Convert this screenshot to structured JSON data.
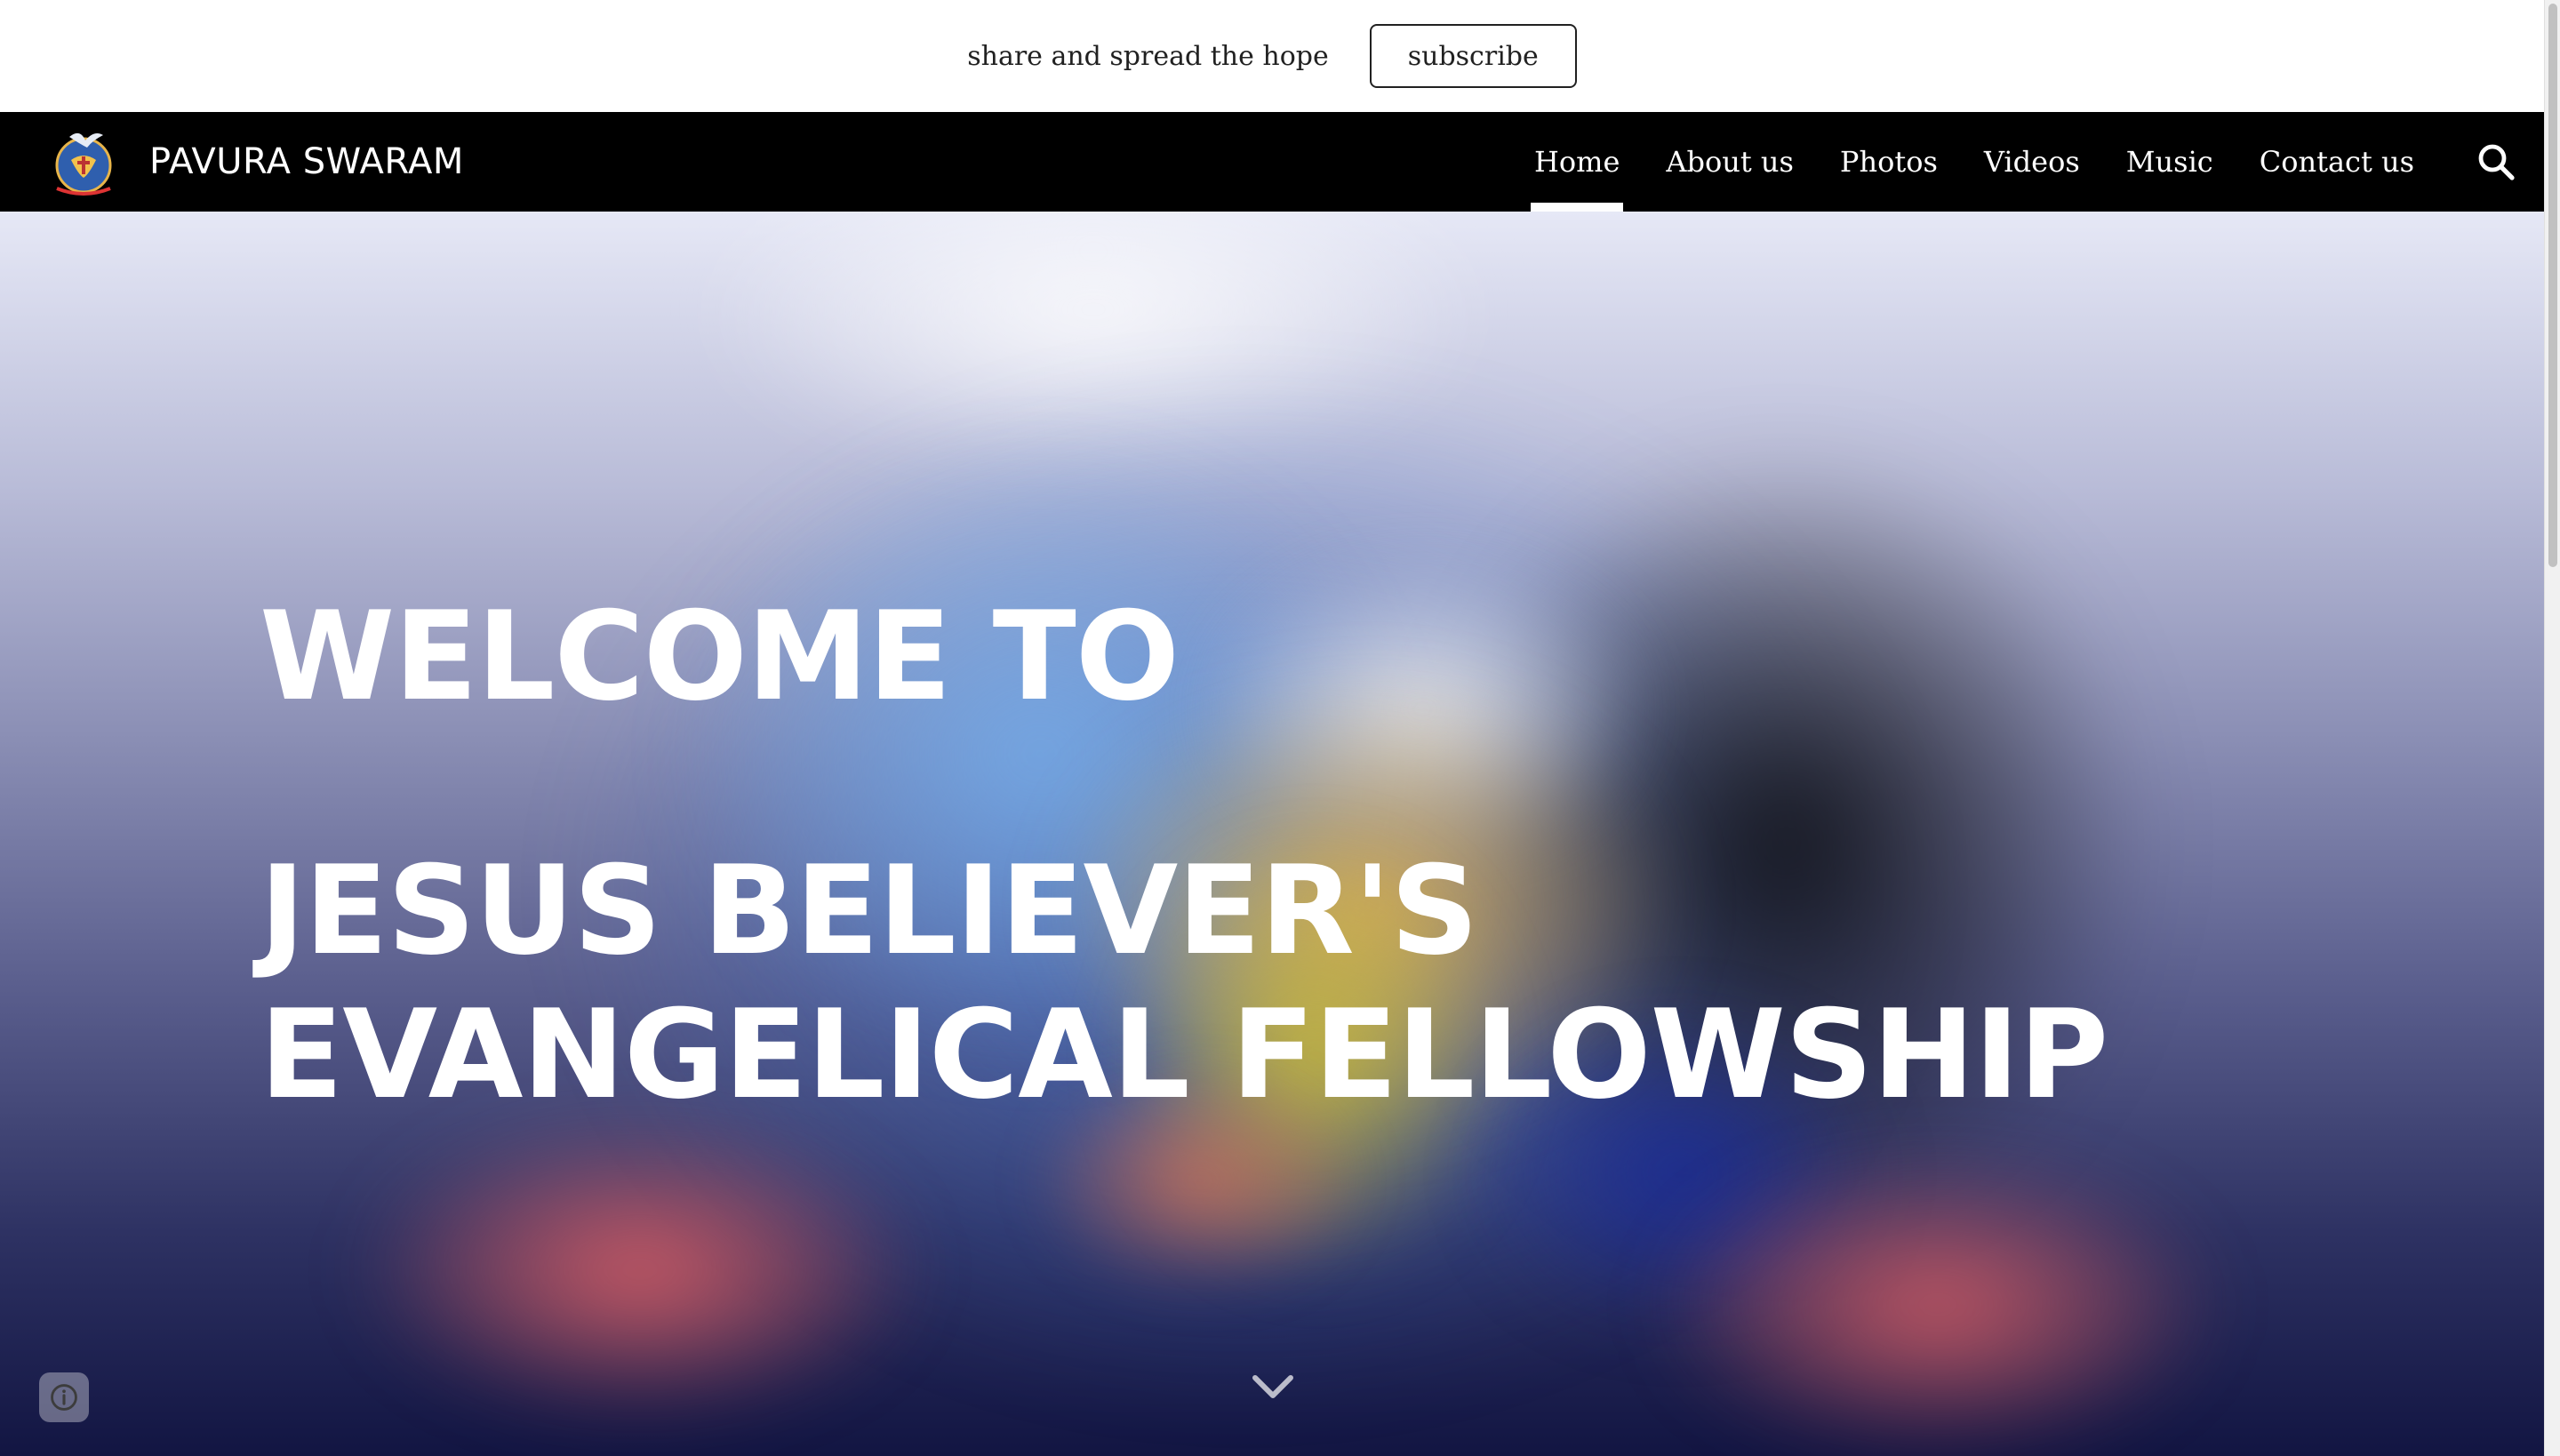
{
  "announcement": {
    "text": "share and spread the hope",
    "button_label": "subscribe"
  },
  "header": {
    "site_title": "PAVURA SWARAM",
    "logo_icon": "dove-globe-logo",
    "nav_items": [
      {
        "label": "Home",
        "active": true
      },
      {
        "label": "About us",
        "active": false
      },
      {
        "label": "Photos",
        "active": false
      },
      {
        "label": "Videos",
        "active": false
      },
      {
        "label": "Music",
        "active": false
      },
      {
        "label": "Contact us",
        "active": false
      }
    ],
    "search_icon": "search-icon"
  },
  "hero": {
    "line1": "WELCOME TO",
    "line2": "JESUS BELIEVER'S EVANGELICAL FELLOWSHIP",
    "scroll_icon": "chevron-down-icon",
    "info_icon": "info-icon"
  },
  "colors": {
    "nav_background": "#000000",
    "nav_text": "#ffffff",
    "announcement_background": "#ffffff",
    "hero_text": "#ffffff"
  }
}
